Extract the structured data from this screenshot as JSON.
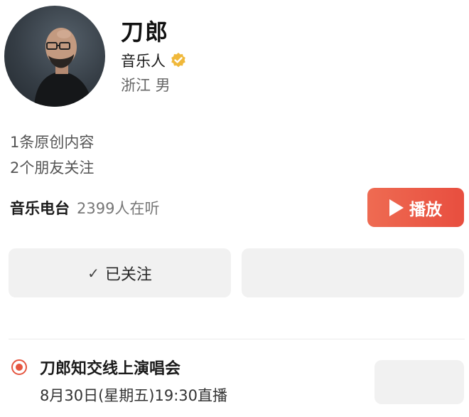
{
  "profile": {
    "name": "刀郎",
    "role": "音乐人",
    "location": "浙江 男",
    "verified_color": "#f0b83a"
  },
  "stats": {
    "original_content": "1条原创内容",
    "friends_following": "2个朋友关注"
  },
  "radio": {
    "title": "音乐电台",
    "listeners": "2399人在听",
    "play_label": "播放"
  },
  "actions": {
    "follow_label": "已关注",
    "check_icon": "✓"
  },
  "live_event": {
    "title": "刀郎知交线上演唱会",
    "time": "8月30日(星期五)19:30直播",
    "accent_color": "#e55640"
  },
  "colors": {
    "play_button": "#ea5a46",
    "button_bg": "#f1f1f1"
  }
}
